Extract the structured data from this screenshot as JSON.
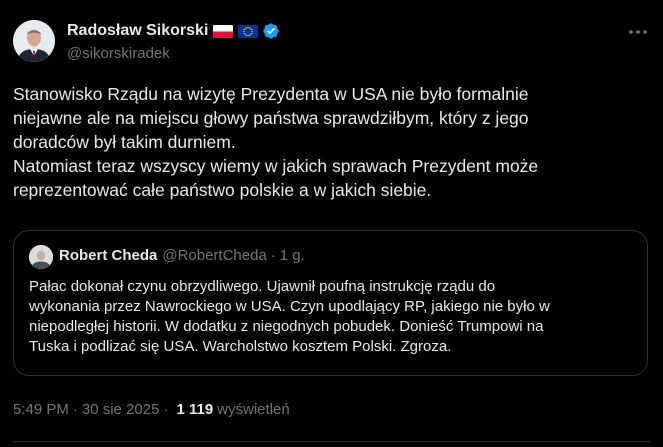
{
  "author": {
    "name": "Radosław Sikorski",
    "handle": "@sikorskiradek",
    "flags": [
      "poland-flag-icon",
      "eu-flag-icon"
    ],
    "verified_icon": "verified-badge-icon"
  },
  "more_icon": "more-horizontal-icon",
  "body": {
    "lines": [
      "Stanowisko Rządu na wizytę Prezydenta w USA nie było formalnie",
      "niejawne ale na miejscu głowy państwa sprawdziłbym, który z jego",
      "doradców był takim durniem.",
      "Natomiast teraz wszyscy wiemy w jakich sprawach Prezydent może",
      "reprezentować całe państwo polskie a w jakich siebie."
    ]
  },
  "quote": {
    "name": "Robert Cheda",
    "handle": "@RobertCheda",
    "separator": "·",
    "time": "1 g.",
    "lines": [
      "Pałac dokonał czynu obrzydliwego. Ujawnił poufną instrukcję rządu do",
      "wykonania przez Nawrockiego w USA. Czyn upodlający RP, jakiego nie było w",
      "niepodległej historii. W dodatku z niegodnych pobudek. Donieść Trumpowi na",
      "Tuska i podlizać się USA. Warcholstwo kosztem Polski. Zgroza."
    ]
  },
  "meta": {
    "time": "5:49 PM",
    "separator": "·",
    "date": "30 sie 2025",
    "views_count": "1 119",
    "views_label": "wyświetleń"
  },
  "colors": {
    "background": "#000000",
    "text": "#e7e9ea",
    "secondary": "#71767b",
    "border": "#2f3336",
    "verified": "#1d9bf0"
  }
}
